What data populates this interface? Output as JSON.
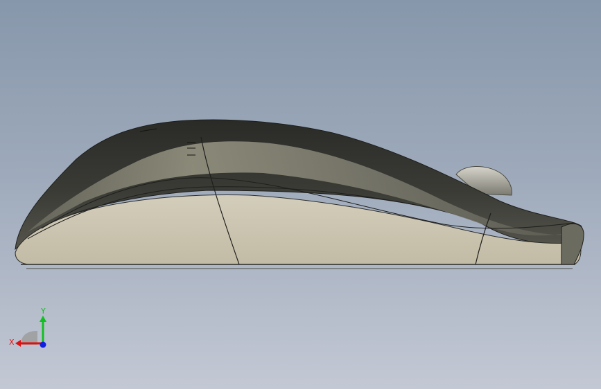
{
  "viewport": {
    "background_top": "#8797ab",
    "background_bottom": "#c3c8d4"
  },
  "model": {
    "shell_color": "#2f302c",
    "side_color": "#cdc6b2",
    "wheel_color": "#8c8a80"
  },
  "triad": {
    "x_label": "X",
    "y_label": "Y",
    "x_color": "#e01010",
    "y_color": "#10c020",
    "z_color": "#1020e0"
  }
}
